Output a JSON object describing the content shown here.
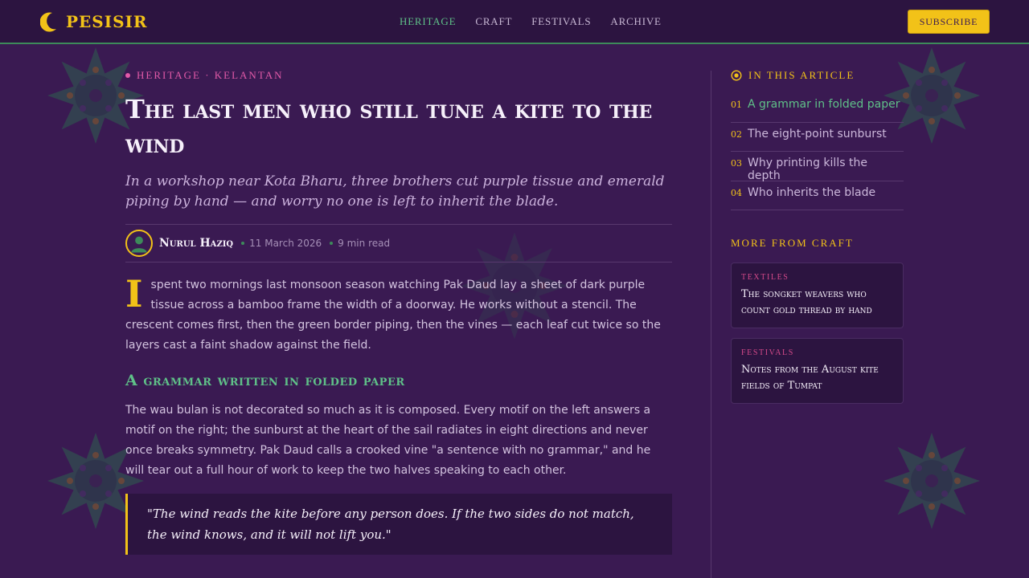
{
  "brand": {
    "name": "PESISIR",
    "icon": "crescent-moon-icon",
    "colors": {
      "gold": "#f2c218",
      "green": "#5fc088",
      "pink": "#e25aa8",
      "purple": "#3a1a52"
    }
  },
  "nav": {
    "links": [
      {
        "label": "HERITAGE",
        "active": true
      },
      {
        "label": "CRAFT",
        "active": false
      },
      {
        "label": "FESTIVALS",
        "active": false
      },
      {
        "label": "ARCHIVE",
        "active": false
      }
    ],
    "subscribe_label": "SUBSCRIBE"
  },
  "article": {
    "kicker": "HERITAGE · KELANTAN",
    "headline": "The last men who still tune a kite to the wind",
    "dek": "In a workshop near Kota Bharu, three brothers cut purple tissue and emerald piping by hand — and worry no one is left to inherit the blade.",
    "author": "Nurul Haziq",
    "date": "11 March 2026",
    "read_time": "9 min read",
    "dropcap": "I",
    "intro": "spent two mornings last monsoon season watching Pak Daud lay a sheet of dark purple tissue across a bamboo frame the width of a doorway. He works without a stencil. The crescent comes first, then the green border piping, then the vines — each leaf cut twice so the layers cast a faint shadow against the field.",
    "section_heading": "A grammar written in folded paper",
    "section_body": "The wau bulan is not decorated so much as it is composed. Every motif on the left answers a motif on the right; the sunburst at the heart of the sail radiates in eight directions and never once breaks symmetry. Pak Daud calls a crooked vine \"a sentence with no grammar,\" and he will tear out a full hour of work to keep the two halves speaking to each other.",
    "pullquote": "\"The wind reads the kite before any person does. If the two sides do not match, the wind knows, and it will not lift you.\""
  },
  "sidebar": {
    "toc_heading": "IN THIS ARTICLE",
    "toc": [
      {
        "num": "01",
        "label": "A grammar in folded paper",
        "active": true
      },
      {
        "num": "02",
        "label": "The eight-point sunburst",
        "active": false
      },
      {
        "num": "03",
        "label": "Why printing kills the depth",
        "active": false
      },
      {
        "num": "04",
        "label": "Who inherits the blade",
        "active": false
      }
    ],
    "more_heading": "MORE FROM CRAFT",
    "cards": [
      {
        "tag": "TEXTILES",
        "title": "The songket weavers who count gold thread by hand"
      },
      {
        "tag": "FESTIVALS",
        "title": "Notes from the August kite fields of Tumpat"
      }
    ]
  }
}
